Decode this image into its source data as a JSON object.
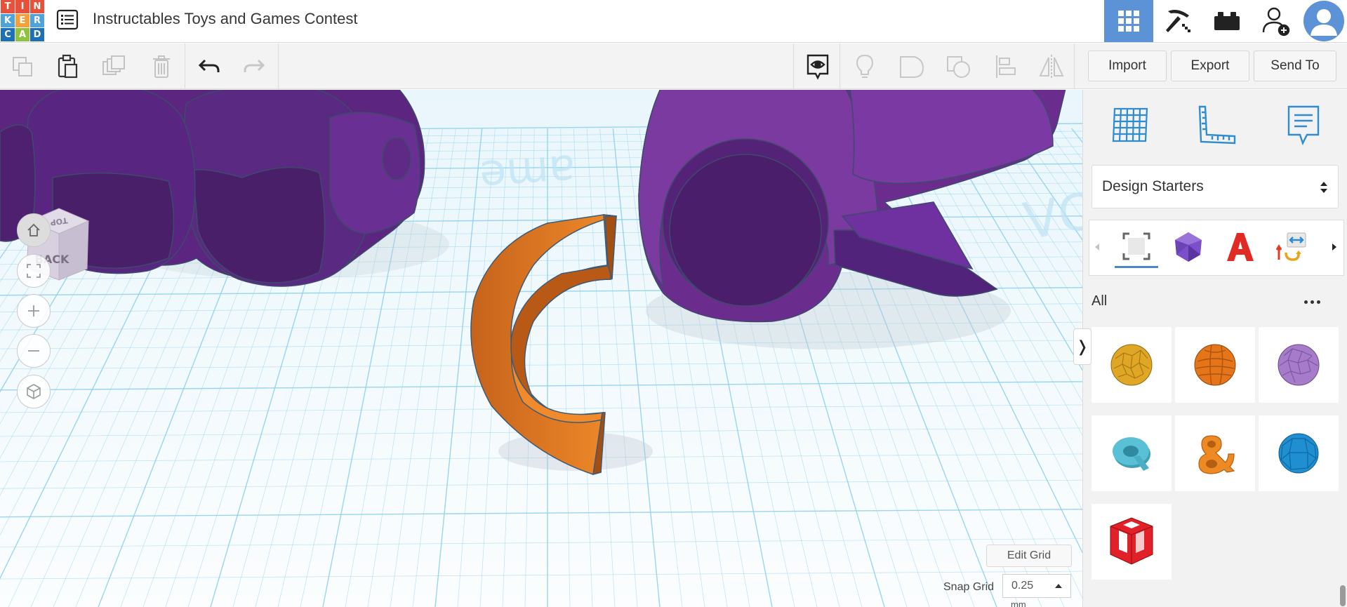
{
  "app": {
    "logo_letters": [
      "T",
      "I",
      "N",
      "K",
      "E",
      "R",
      "C",
      "A",
      "D"
    ],
    "logo_colors": [
      "#e8503a",
      "#e8503a",
      "#e8503a",
      "#4fa3dc",
      "#f2a13a",
      "#4fa3dc",
      "#1d6fb8",
      "#8fc23f",
      "#1d6fb8"
    ],
    "design_title": "Instructables Toys and Games Contest"
  },
  "topbar": {
    "icons": [
      "3d-view-grid-icon",
      "pickaxe-icon",
      "bricks-icon",
      "add-user-icon",
      "user-avatar-icon"
    ],
    "active_color": "#5b93d6"
  },
  "toolbar": {
    "import_label": "Import",
    "export_label": "Export",
    "send_to_label": "Send To"
  },
  "workplane": {
    "viewcube": {
      "top_label": "TOP",
      "back_label": "BACK"
    },
    "grid_color": "#8fd0ec",
    "edit_grid_label": "Edit Grid",
    "snap_grid_label": "Snap Grid",
    "snap_grid_value": "0.25",
    "snap_grid_unit": "mm",
    "colors": {
      "purple": "#6a2d8e",
      "purple_dark": "#4a1d66",
      "orange": "#ef7f22",
      "orange_dark": "#b85a16"
    }
  },
  "panel": {
    "top_icons": [
      "workplane-icon",
      "ruler-icon",
      "notes-icon"
    ],
    "shape_library": "Design Starters",
    "category_tabs": [
      "shapes-icon",
      "polyhedron-icon",
      "text-icon",
      "connectors-icon"
    ],
    "section_label": "All",
    "shapes": [
      {
        "name": "gold-sphere",
        "color": "#e0a727"
      },
      {
        "name": "orange-sphere",
        "color": "#e67418"
      },
      {
        "name": "lavender-sphere",
        "color": "#a67bc9"
      },
      {
        "name": "cyan-letter-q",
        "color": "#59c0d6"
      },
      {
        "name": "orange-ampersand",
        "color": "#ee8a24"
      },
      {
        "name": "blue-polyhedron",
        "color": "#1f8fd1"
      },
      {
        "name": "red-cage-cube",
        "color": "#e22028"
      }
    ]
  }
}
